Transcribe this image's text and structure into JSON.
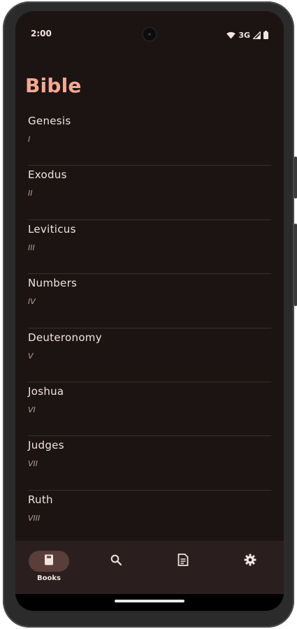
{
  "status_bar": {
    "time": "2:00",
    "network": "3G",
    "icons": [
      "wifi-icon",
      "signal-icon",
      "battery-icon"
    ]
  },
  "header": {
    "title": "Bible"
  },
  "books": [
    {
      "name": "Genesis",
      "numeral": "I"
    },
    {
      "name": "Exodus",
      "numeral": "II"
    },
    {
      "name": "Leviticus",
      "numeral": "III"
    },
    {
      "name": "Numbers",
      "numeral": "IV"
    },
    {
      "name": "Deuteronomy",
      "numeral": "V"
    },
    {
      "name": "Joshua",
      "numeral": "VI"
    },
    {
      "name": "Judges",
      "numeral": "VII"
    },
    {
      "name": "Ruth",
      "numeral": "VIII"
    }
  ],
  "bottom_nav": {
    "items": [
      {
        "label": "Books",
        "icon": "book-icon",
        "selected": true
      },
      {
        "label": "",
        "icon": "search-icon",
        "selected": false
      },
      {
        "label": "",
        "icon": "document-icon",
        "selected": false
      },
      {
        "label": "",
        "icon": "gear-icon",
        "selected": false
      }
    ]
  },
  "colors": {
    "background": "#1c1413",
    "accent": "#f4a990",
    "text": "#f2e4e0",
    "subtext": "#b59f98",
    "nav_background": "#2a1f1e",
    "nav_selected": "#5a3e39"
  }
}
